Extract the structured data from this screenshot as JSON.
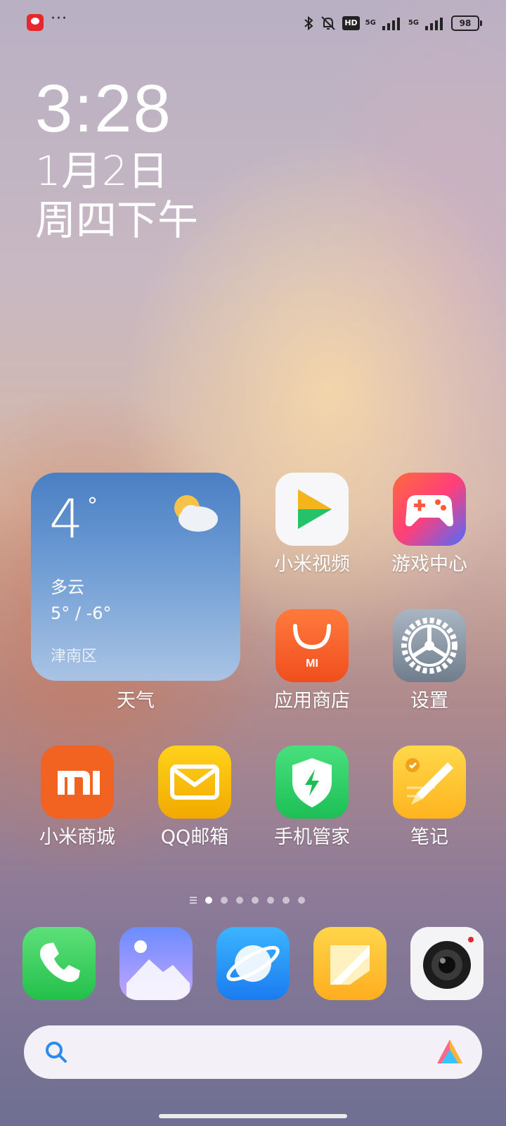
{
  "status_bar": {
    "more_dots": "···",
    "hd_label": "HD",
    "net1": "5G",
    "net2": "5G",
    "battery": "98",
    "icons": [
      "app-badge-icon",
      "bluetooth-icon",
      "bell-muted-icon",
      "signal-icon",
      "signal-icon"
    ]
  },
  "clock": {
    "time": "3:28",
    "date": "1月2日",
    "weekday": "周四下午"
  },
  "weather": {
    "temp": "4",
    "deg": "°",
    "condition": "多云",
    "range": "5° / -6°",
    "location": "津南区",
    "label": "天气",
    "icon": "partly-cloudy-icon"
  },
  "apps": {
    "row1": [
      {
        "label": "小米视频",
        "icon": "video-play-icon"
      },
      {
        "label": "游戏中心",
        "icon": "gamepad-icon"
      }
    ],
    "row2": [
      {
        "label": "应用商店",
        "icon": "shopping-bag-icon"
      },
      {
        "label": "设置",
        "icon": "gear-icon"
      }
    ],
    "row3": [
      {
        "label": "小米商城",
        "icon": "mi-logo-icon"
      },
      {
        "label": "QQ邮箱",
        "icon": "envelope-icon"
      },
      {
        "label": "手机管家",
        "icon": "shield-bolt-icon"
      },
      {
        "label": "笔记",
        "icon": "note-pencil-icon"
      }
    ]
  },
  "dock": [
    "phone-icon",
    "gallery-icon",
    "browser-icon",
    "notes-icon",
    "camera-icon"
  ],
  "search": {
    "icon": "search-icon",
    "assistant_icon": "assistant-logo-icon"
  },
  "colors": {
    "weather_top": "#4a7fc4",
    "store_orange": "#f26322",
    "security_green": "#2fd465",
    "mail_yellow": "#f5c800"
  }
}
